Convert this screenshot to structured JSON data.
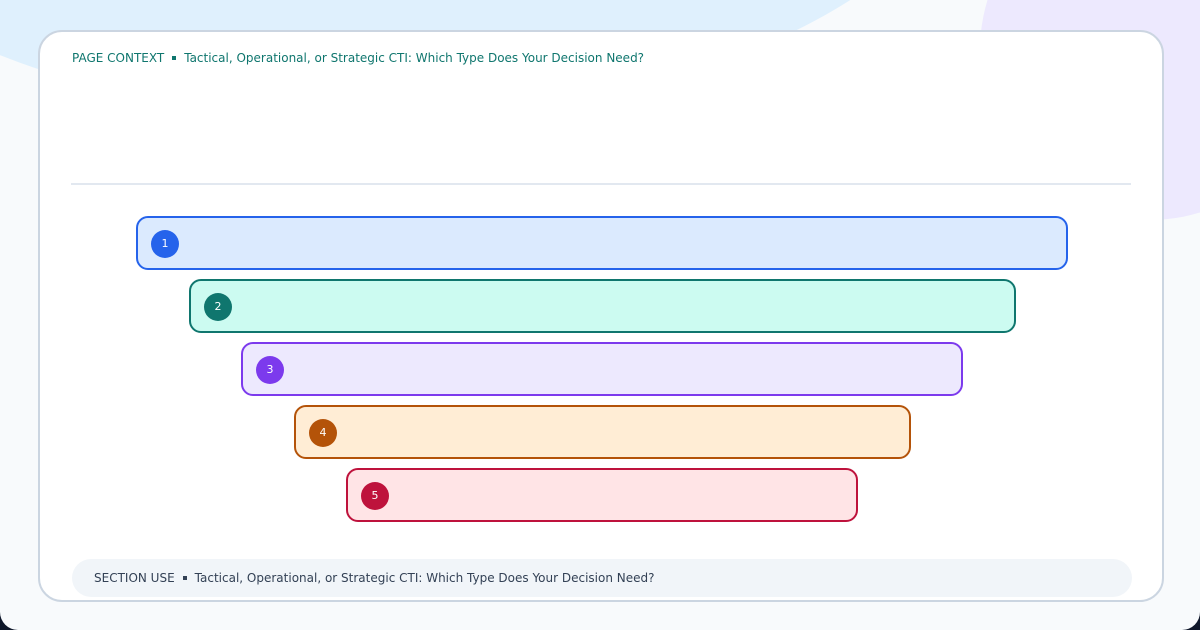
{
  "context": {
    "label": "PAGE CONTEXT",
    "title": "Tactical, Operational, or Strategic CTI: Which Type Does Your Decision Need?"
  },
  "diagram": {
    "tiers": [
      {
        "number": "1",
        "border": "#2563eb",
        "fill": "#dbeafe",
        "badge": "#2563eb"
      },
      {
        "number": "2",
        "border": "#0f766e",
        "fill": "#ccfbf1",
        "badge": "#0f766e"
      },
      {
        "number": "3",
        "border": "#7c3aed",
        "fill": "#ede9fe",
        "badge": "#7c3aed"
      },
      {
        "number": "4",
        "border": "#b45309",
        "fill": "#ffedd5",
        "badge": "#b45309"
      },
      {
        "number": "5",
        "border": "#be123c",
        "fill": "#ffe4e6",
        "badge": "#be123c"
      }
    ]
  },
  "section": {
    "label": "SECTION USE",
    "title": "Tactical, Operational, or Strategic CTI: Which Type Does Your Decision Need?"
  }
}
